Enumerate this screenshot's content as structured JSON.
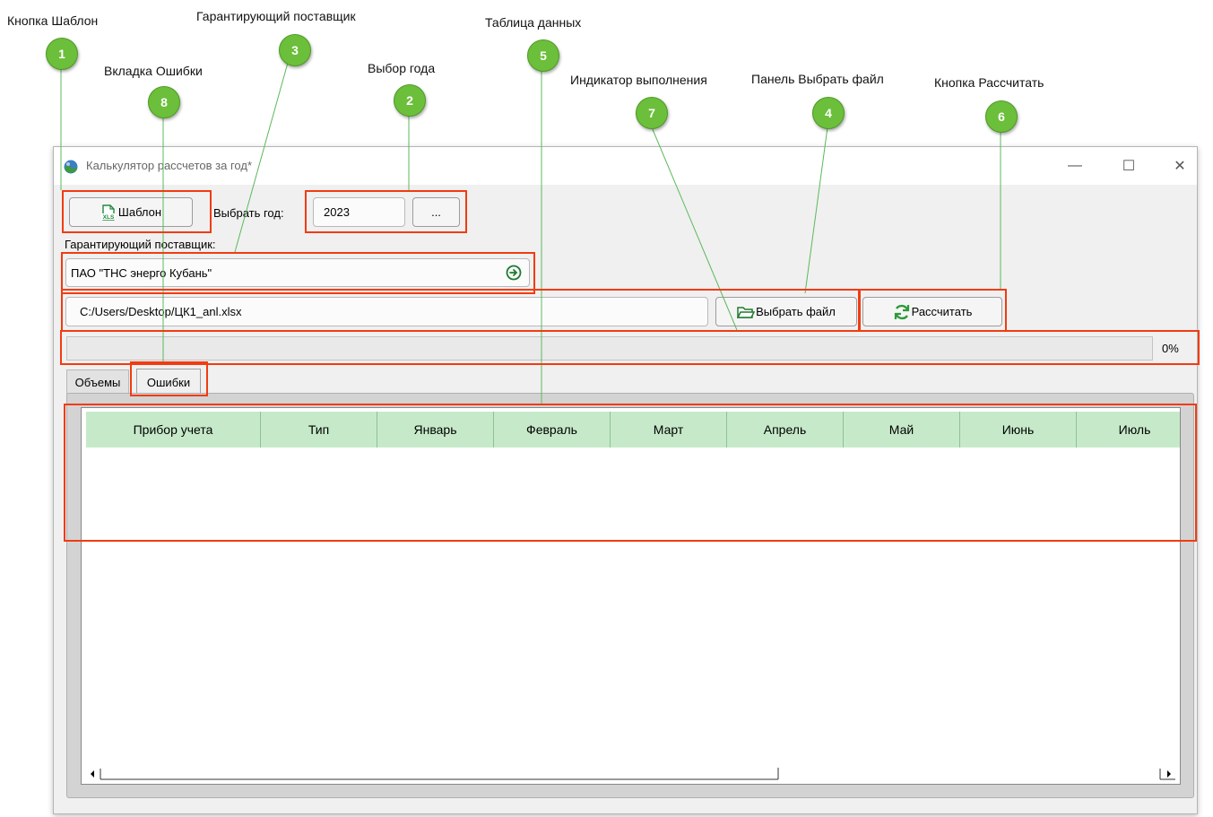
{
  "annotations": [
    {
      "num": "1",
      "label": "Кнопка Шаблон"
    },
    {
      "num": "2",
      "label": "Выбор года"
    },
    {
      "num": "3",
      "label": "Гарантирующий поставщик"
    },
    {
      "num": "4",
      "label": "Панель Выбрать файл"
    },
    {
      "num": "5",
      "label": "Таблица данных"
    },
    {
      "num": "6",
      "label": "Кнопка Рассчитать"
    },
    {
      "num": "7",
      "label": "Индикатор выполнения"
    },
    {
      "num": "8",
      "label": "Вкладка Ошибки"
    }
  ],
  "window": {
    "title": "Калькулятор рассчетов за год*",
    "minimize": "—",
    "maximize": "☐",
    "close": "✕"
  },
  "toolbar": {
    "template_button": "Шаблон",
    "year_label": "Выбрать год:",
    "year_value": "2023",
    "year_picker_button": "...",
    "supplier_label": "Гарантирующий поставщик:",
    "supplier_value": "ПАО \"ТНС энерго Кубань\"",
    "file_path": "C:/Users/Desktop/ЦК1_anl.xlsx",
    "choose_file_button": "Выбрать файл",
    "calculate_button": "Рассчитать"
  },
  "progress": {
    "value": 0,
    "text": "0%"
  },
  "tabs": [
    {
      "label": "Объемы",
      "active": false
    },
    {
      "label": "Ошибки",
      "active": true
    }
  ],
  "table": {
    "columns": [
      "Прибор учета",
      "Тип",
      "Январь",
      "Февраль",
      "Март",
      "Апрель",
      "Май",
      "Июнь",
      "Июль"
    ],
    "rows": []
  },
  "colors": {
    "annotation_badge": "#6bbf3a",
    "highlight": "#f03c12",
    "table_header": "#c6eac9"
  }
}
